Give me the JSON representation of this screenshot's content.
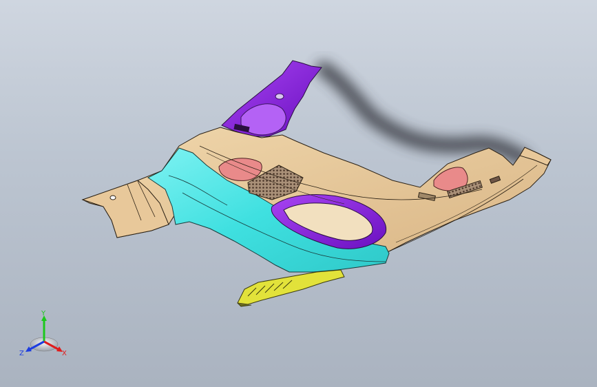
{
  "viewport": {
    "background_top": "#cfd6e0",
    "background_bottom": "#aab3c0"
  },
  "model": {
    "parts": [
      {
        "name": "main-trim-panel",
        "color": "#e8c89a"
      },
      {
        "name": "cyan-side-panel",
        "color": "#4fe6e6"
      },
      {
        "name": "purple-pillar-bracket",
        "color": "#8a22e0"
      },
      {
        "name": "purple-console-bezel",
        "color": "#8a22e0"
      },
      {
        "name": "red-lamp-left",
        "color": "#e98a8a"
      },
      {
        "name": "red-lamp-right",
        "color": "#e98a8a"
      },
      {
        "name": "yellow-front-strip",
        "color": "#e2e23a"
      },
      {
        "name": "speaker-grille",
        "color": "#6e5546"
      }
    ]
  },
  "triad": {
    "y_label": "Y",
    "x_label": "X",
    "z_label": "Z",
    "y_color": "#1cc81c",
    "x_color": "#e01c1c",
    "z_color": "#1c3ce0"
  }
}
